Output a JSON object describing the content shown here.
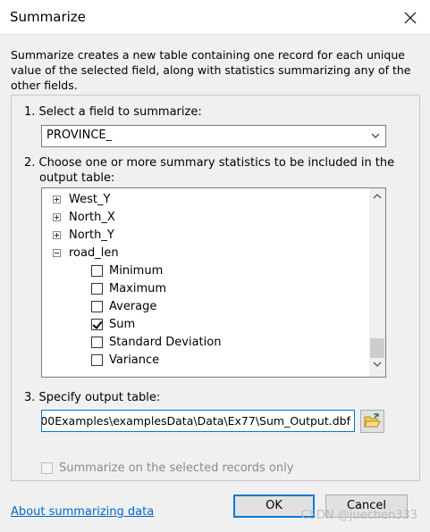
{
  "window": {
    "title": "Summarize"
  },
  "description": "Summarize creates a new table containing one record for each unique value of the selected field, along with statistics summarizing any of the other fields.",
  "step1": {
    "label": "1.  Select a field to summarize:",
    "field_value": "PROVINCE_"
  },
  "step2": {
    "label_line1": "2.  Choose one or more summary statistics to be included in the",
    "label_line2": "output table:",
    "tree": [
      {
        "label": "West_Y",
        "state": "collapsed"
      },
      {
        "label": "North_X",
        "state": "collapsed"
      },
      {
        "label": "North_Y",
        "state": "collapsed"
      },
      {
        "label": "road_len",
        "state": "expanded"
      }
    ],
    "stats": [
      {
        "label": "Minimum",
        "checked": false
      },
      {
        "label": "Maximum",
        "checked": false
      },
      {
        "label": "Average",
        "checked": false
      },
      {
        "label": "Sum",
        "checked": true
      },
      {
        "label": "Standard Deviation",
        "checked": false
      },
      {
        "label": "Variance",
        "checked": false
      }
    ]
  },
  "step3": {
    "label": "3.  Specify output table:",
    "output_path": "l00Examples\\examplesData\\Data\\Ex77\\Sum_Output.dbf"
  },
  "summarize_selected": {
    "label": "Summarize on the selected records only",
    "checked": false,
    "enabled": false
  },
  "footer": {
    "help_link": "About summarizing data",
    "ok_label": "OK",
    "cancel_label": "Cancel"
  },
  "watermark": "CSDN @juechen333",
  "colors": {
    "accent": "#0078d7",
    "link": "#0066cc",
    "titlebar": "#ffffff",
    "dialog": "#f0f0f0"
  }
}
